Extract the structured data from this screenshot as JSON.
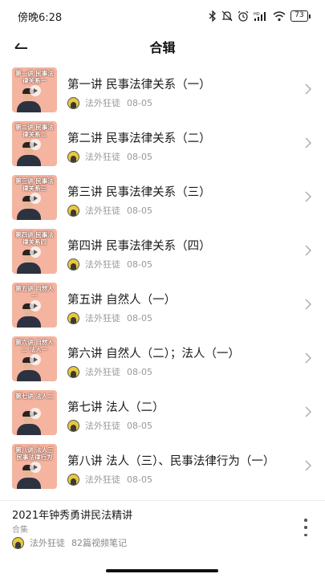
{
  "status_bar": {
    "time": "傍晚6:28",
    "battery": "73"
  },
  "header": {
    "title": "合辑"
  },
  "items": [
    {
      "title": "第一讲 民事法律关系（一）",
      "author": "法外狂徒",
      "date": "08-05",
      "thumb_text": "第一讲 民事法律关系一"
    },
    {
      "title": "第二讲 民事法律关系（二）",
      "author": "法外狂徒",
      "date": "08-05",
      "thumb_text": "第二讲 民事法律关系二"
    },
    {
      "title": "第三讲 民事法律关系（三）",
      "author": "法外狂徒",
      "date": "08-05",
      "thumb_text": "第三讲 民事法律关系三"
    },
    {
      "title": "第四讲 民事法律关系（四）",
      "author": "法外狂徒",
      "date": "08-05",
      "thumb_text": "第四讲 民事法律关系四"
    },
    {
      "title": "第五讲 自然人（一）",
      "author": "法外狂徒",
      "date": "08-05",
      "thumb_text": "第五讲 自然人一"
    },
    {
      "title": "第六讲 自然人（二）；法人（一）",
      "author": "法外狂徒",
      "date": "08-05",
      "thumb_text": "第六讲 自然人二 法人一"
    },
    {
      "title": "第七讲 法人（二）",
      "author": "法外狂徒",
      "date": "08-05",
      "thumb_text": "第七讲 法人二"
    },
    {
      "title": "第八讲 法人（三）、民事法律行为（一）",
      "author": "法外狂徒",
      "date": "08-05",
      "thumb_text": "第八讲 法人三 民事法律行为一"
    }
  ],
  "collection": {
    "title": "2021年钟秀勇讲民法精讲",
    "type": "合集",
    "author": "法外狂徒",
    "count": "82篇视频笔记"
  },
  "icons": {
    "back": "arrow-left-icon",
    "chevron": "chevron-right-icon",
    "more": "more-vertical-icon"
  },
  "colors": {
    "thumbnail_bg": "#f4b4a0",
    "meta_text": "#999999"
  }
}
